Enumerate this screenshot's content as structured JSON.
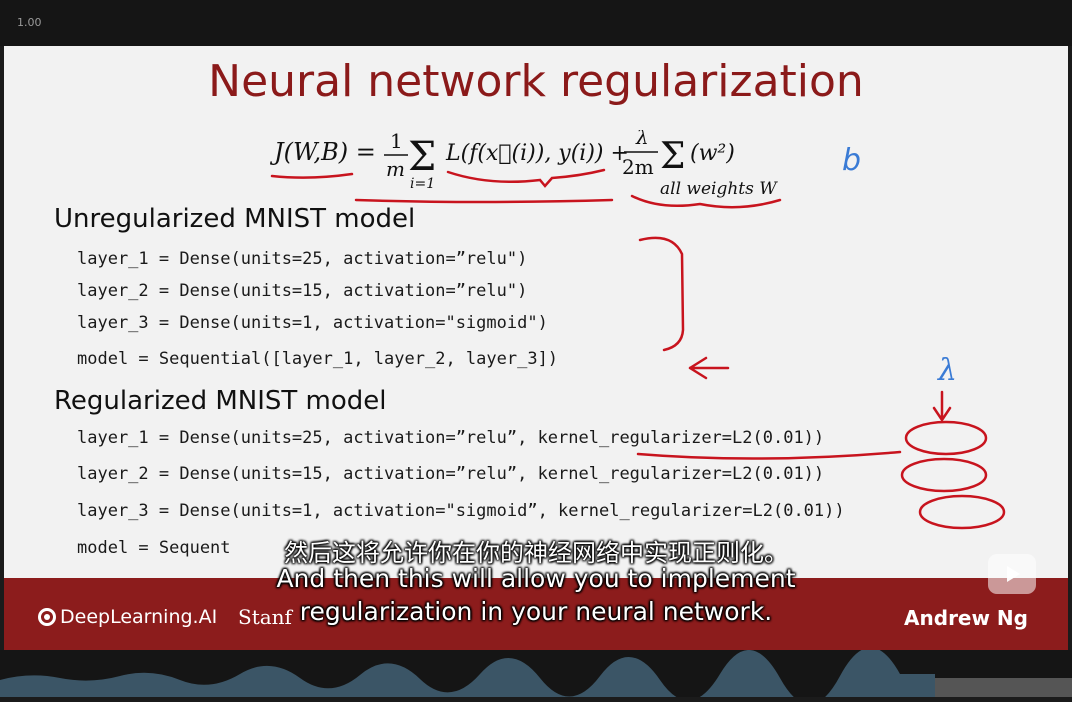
{
  "player": {
    "speed_label": "1.00"
  },
  "slide": {
    "title": "Neural network regularization",
    "formula": {
      "lhs": "J(W,B) =",
      "frac_num": "1",
      "frac_den": "m",
      "sum_top": "m",
      "sum_bottom": "i=1",
      "loss_term": "L(f(x⃗(i)), y(i)) +",
      "lambda": "λ",
      "lambda_den": "2m",
      "reg_term": "(w²)",
      "reg_sub": "all weights W"
    },
    "unreg_heading": "Unregularized MNIST model",
    "unreg_code": [
      "layer_1 = Dense(units=25, activation=”relu\")",
      "layer_2 = Dense(units=15, activation=”relu\")",
      "layer_3 = Dense(units=1, activation=\"sigmoid\")",
      "model = Sequential([layer_1, layer_2, layer_3])"
    ],
    "reg_heading": "Regularized MNIST model",
    "reg_code": [
      "layer_1 = Dense(units=25, activation=”relu”, kernel_regularizer=L2(0.01))",
      "layer_2 = Dense(units=15, activation=”relu”, kernel_regularizer=L2(0.01))",
      "layer_3 = Dense(units=1, activation=\"sigmoid”, kernel_regularizer=L2(0.01))",
      "model = Sequent"
    ],
    "annotations": {
      "b": "b",
      "lambda": "λ",
      "ink_red": "#c8141e",
      "ink_blue": "#3a7bd5"
    },
    "footer": {
      "brand": "DeepLearning.AI",
      "partner": "Stanf",
      "author": "Andrew Ng"
    }
  },
  "subtitles": {
    "zh": "然后这将允许你在你的神经网络中实现正则化。",
    "en_line1": "And then this will allow you to implement",
    "en_line2": "regularization in your neural network."
  },
  "colors": {
    "title": "#8b1a1a",
    "footer": "#8c1c1c",
    "waveform": "#3b5566"
  }
}
